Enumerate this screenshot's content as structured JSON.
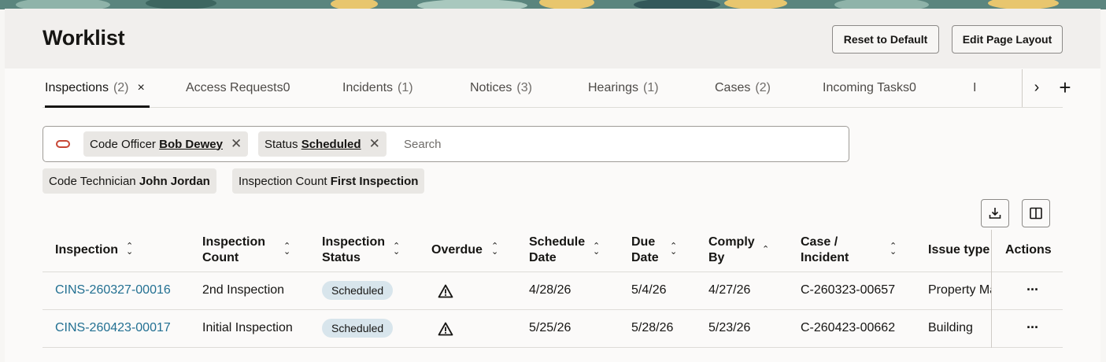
{
  "header": {
    "title": "Worklist",
    "reset_label": "Reset to Default",
    "edit_layout_label": "Edit Page Layout"
  },
  "tabs": [
    {
      "label": "Inspections",
      "count": "(2)",
      "close": "×"
    },
    {
      "label": "Access Requests0",
      "count": ""
    },
    {
      "label": "Incidents",
      "count": "(1)"
    },
    {
      "label": "Notices",
      "count": "(3)"
    },
    {
      "label": "Hearings",
      "count": "(1)"
    },
    {
      "label": "Cases",
      "count": "(2)"
    },
    {
      "label": "Incoming Tasks0",
      "count": ""
    },
    {
      "label": "I",
      "count": ""
    }
  ],
  "tab_controls": {
    "next": "›",
    "add": "+"
  },
  "filters": {
    "chips": [
      {
        "key": "Code Officer",
        "value": "Bob Dewey"
      },
      {
        "key": "Status",
        "value": "Scheduled"
      }
    ],
    "search_placeholder": "Search",
    "applied": [
      {
        "key": "Code Technician",
        "value": "John Jordan"
      },
      {
        "key": "Inspection Count",
        "value": "First Inspection"
      }
    ]
  },
  "icons": {
    "download": "download-icon",
    "columns": "columns-icon",
    "warning": "warning-icon",
    "more": "more-actions-icon"
  },
  "table": {
    "columns": [
      {
        "line1": "Inspection",
        "line2": ""
      },
      {
        "line1": "Inspection",
        "line2": "Count"
      },
      {
        "line1": "Inspection",
        "line2": "Status"
      },
      {
        "line1": "Overdue",
        "line2": ""
      },
      {
        "line1": "Schedule",
        "line2": "Date"
      },
      {
        "line1": "Due",
        "line2": "Date"
      },
      {
        "line1": "Comply",
        "line2": "By"
      },
      {
        "line1": "Case /",
        "line2": "Incident"
      },
      {
        "line1": "Issue type",
        "line2": ""
      },
      {
        "line1": "Actions",
        "line2": ""
      }
    ],
    "rows": [
      {
        "inspection": "CINS-260327-00016",
        "count": "2nd Inspection",
        "status": "Scheduled",
        "schedule_date": "4/28/26",
        "due_date": "5/4/26",
        "comply_by": "4/27/26",
        "case": "C-260323-00657",
        "issue_type": "Property Maintenance",
        "actions": "···"
      },
      {
        "inspection": "CINS-260423-00017",
        "count": "Initial Inspection",
        "status": "Scheduled",
        "schedule_date": "5/25/26",
        "due_date": "5/28/26",
        "comply_by": "5/23/26",
        "case": "C-260423-00662",
        "issue_type": "Building",
        "actions": "···"
      }
    ]
  },
  "colors": {
    "link": "#227092",
    "oracle_red": "#c74634",
    "badge_bg": "#d8e5ec"
  }
}
